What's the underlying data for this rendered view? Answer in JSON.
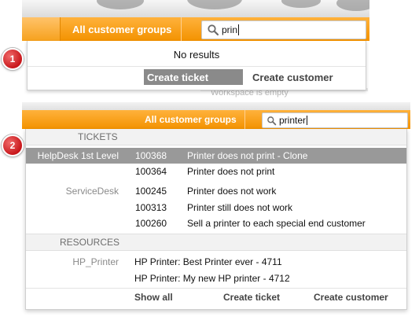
{
  "panel1": {
    "badge": "1",
    "groups_label": "All customer groups",
    "search_value": "prin",
    "no_results": "No results",
    "create_ticket": "Create ticket",
    "create_customer": "Create customer",
    "workspace_msg": "Workspace is empty"
  },
  "panel2": {
    "badge": "2",
    "groups_label": "All customer groups",
    "search_value": "printer",
    "tickets_header": "TICKETS",
    "tickets": [
      {
        "group": "HelpDesk 1st Level",
        "id": "100368",
        "title": "Printer does not print - Clone",
        "selected": true
      },
      {
        "group": "",
        "id": "100364",
        "title": "Printer does not print",
        "selected": false
      },
      {
        "group": "ServiceDesk",
        "id": "100245",
        "title": "Printer does not work",
        "selected": false
      },
      {
        "group": "",
        "id": "100313",
        "title": "Printer still does not work",
        "selected": false
      },
      {
        "group": "",
        "id": "100260",
        "title": "Sell a printer to each special end customer",
        "selected": false
      }
    ],
    "resources_header": "RESOURCES",
    "resources": [
      {
        "group": "HP_Printer",
        "text": "HP Printer: Best Printer ever - 4711"
      },
      {
        "group": "",
        "text": "HP Printer: My new HP printer - 4712"
      }
    ],
    "footer": {
      "show_all": "Show all",
      "create_ticket": "Create ticket",
      "create_customer": "Create customer"
    }
  },
  "colors": {
    "accent_orange": "#f39200",
    "badge_red": "#c8171b",
    "selected_row": "#999999",
    "section_header_bg": "#f2f2f2"
  },
  "icons": {
    "search": "magnifier-icon",
    "badge": "numbered-red-circle"
  }
}
